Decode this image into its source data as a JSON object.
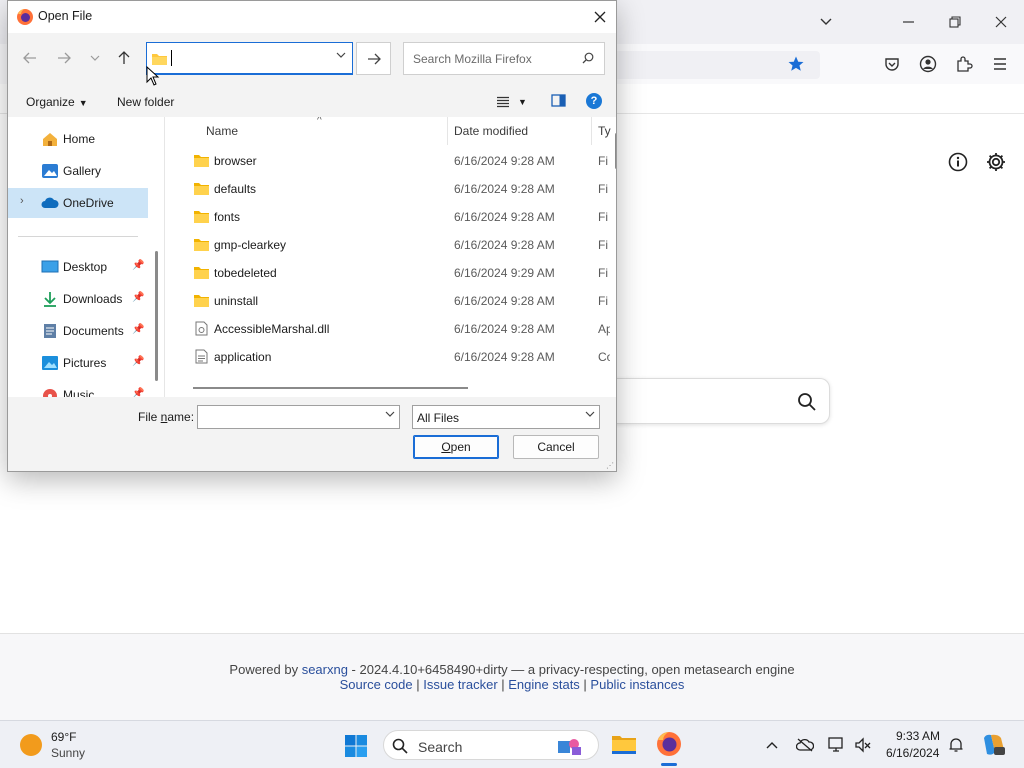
{
  "browser": {
    "footer": {
      "powered_prefix": "Powered by ",
      "searxng_link": "searxng",
      "version_text": " - 2024.4.10+6458490+dirty — a privacy-respecting, open metasearch engine",
      "links": [
        "Source code",
        "Issue tracker",
        "Engine stats",
        "Public instances"
      ],
      "separator": " | "
    },
    "colors": {
      "accent": "#1a6dd6",
      "star": "#1a6dd6"
    }
  },
  "dialog": {
    "title": "Open File",
    "address": {
      "value": ""
    },
    "search": {
      "placeholder": "Search Mozilla Firefox"
    },
    "toolbar": {
      "organize": "Organize",
      "new_folder": "New folder",
      "help": "?"
    },
    "nav": [
      {
        "label": "Home",
        "icon": "home-icon"
      },
      {
        "label": "Gallery",
        "icon": "gallery-icon"
      },
      {
        "label": "OneDrive",
        "icon": "cloud-icon",
        "selected": true
      },
      {
        "label": "Desktop",
        "icon": "desktop-icon",
        "pinned": true
      },
      {
        "label": "Downloads",
        "icon": "download-icon",
        "pinned": true
      },
      {
        "label": "Documents",
        "icon": "document-icon",
        "pinned": true
      },
      {
        "label": "Pictures",
        "icon": "pictures-icon",
        "pinned": true
      },
      {
        "label": "Music",
        "icon": "music-icon",
        "pinned": true
      }
    ],
    "columns": {
      "name": "Name",
      "date": "Date modified",
      "type": "Ty"
    },
    "files": [
      {
        "name": "browser",
        "date": "6/16/2024 9:28 AM",
        "type": "Fi",
        "kind": "folder"
      },
      {
        "name": "defaults",
        "date": "6/16/2024 9:28 AM",
        "type": "Fi",
        "kind": "folder"
      },
      {
        "name": "fonts",
        "date": "6/16/2024 9:28 AM",
        "type": "Fi",
        "kind": "folder"
      },
      {
        "name": "gmp-clearkey",
        "date": "6/16/2024 9:28 AM",
        "type": "Fi",
        "kind": "folder"
      },
      {
        "name": "tobedeleted",
        "date": "6/16/2024 9:29 AM",
        "type": "Fi",
        "kind": "folder"
      },
      {
        "name": "uninstall",
        "date": "6/16/2024 9:28 AM",
        "type": "Fi",
        "kind": "folder"
      },
      {
        "name": "AccessibleMarshal.dll",
        "date": "6/16/2024 9:28 AM",
        "type": "Ap",
        "kind": "dll"
      },
      {
        "name": "application",
        "date": "6/16/2024 9:28 AM",
        "type": "Co",
        "kind": "config"
      }
    ],
    "filename": {
      "label_pre": "File ",
      "label_key": "n",
      "label_post": "ame:",
      "value": ""
    },
    "filter": {
      "value": "All Files"
    },
    "buttons": {
      "open_key": "O",
      "open_rest": "pen",
      "cancel": "Cancel"
    }
  },
  "taskbar": {
    "weather": {
      "temp": "69°F",
      "condition": "Sunny"
    },
    "search_label": "Search",
    "clock": {
      "time": "9:33 AM",
      "date": "6/16/2024"
    }
  }
}
